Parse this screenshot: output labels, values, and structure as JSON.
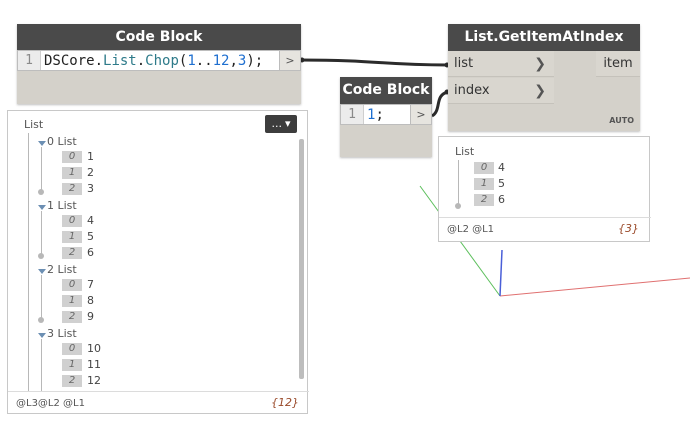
{
  "node1": {
    "title": "Code Block",
    "line_number": "1",
    "code": {
      "prefix": "DSCore.",
      "class_name": "List",
      "dot": ".",
      "method": "Chop",
      "open": "(",
      "range_start": "1",
      "range_op": "..",
      "range_end": "12",
      "comma": ",",
      "chunk": "3",
      "close": ");"
    },
    "out_port": ">"
  },
  "node2": {
    "title": "Code Block",
    "line_number": "1",
    "code_value": "1",
    "code_end": ";",
    "out_port": ">"
  },
  "node3": {
    "title": "List.GetItemAtIndex",
    "inputs": [
      "list",
      "index"
    ],
    "output": "item",
    "lacing": "AUTO"
  },
  "preview1": {
    "root": "List",
    "groups": [
      {
        "label": "0 List",
        "items": [
          {
            "i": "0",
            "v": "1"
          },
          {
            "i": "1",
            "v": "2"
          },
          {
            "i": "2",
            "v": "3"
          }
        ]
      },
      {
        "label": "1 List",
        "items": [
          {
            "i": "0",
            "v": "4"
          },
          {
            "i": "1",
            "v": "5"
          },
          {
            "i": "2",
            "v": "6"
          }
        ]
      },
      {
        "label": "2 List",
        "items": [
          {
            "i": "0",
            "v": "7"
          },
          {
            "i": "1",
            "v": "8"
          },
          {
            "i": "2",
            "v": "9"
          }
        ]
      },
      {
        "label": "3 List",
        "items": [
          {
            "i": "0",
            "v": "10"
          },
          {
            "i": "1",
            "v": "11"
          },
          {
            "i": "2",
            "v": "12"
          }
        ]
      }
    ],
    "pin_label": "...",
    "levels": "@L3@L2 @L1",
    "count": "{12}"
  },
  "preview2": {
    "root": "List",
    "items": [
      {
        "i": "0",
        "v": "4"
      },
      {
        "i": "1",
        "v": "5"
      },
      {
        "i": "2",
        "v": "6"
      }
    ],
    "levels": "@L2 @L1",
    "count": "{3}"
  },
  "colors": {
    "header": "#4a4a4a",
    "node_body": "#d4d1ca",
    "axis_x": "#e05050",
    "axis_y": "#40b040",
    "axis_z": "#4060d0",
    "wire": "#333333"
  }
}
